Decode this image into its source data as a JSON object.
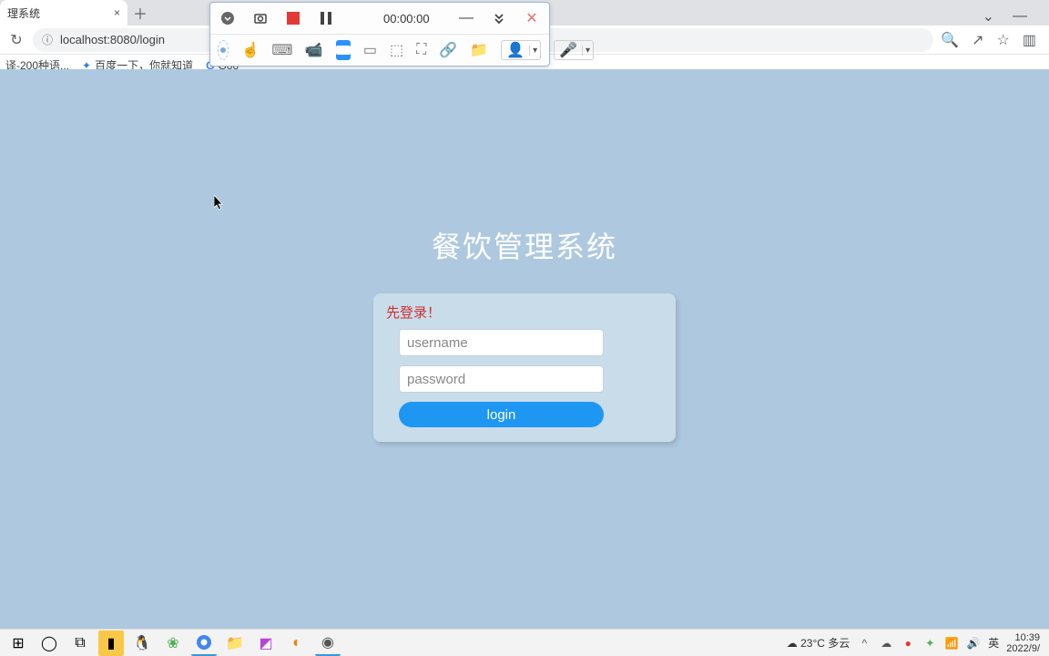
{
  "browser": {
    "tab_title": "理系统",
    "url": "localhost:8080/login",
    "bookmarks": [
      "译-200种语...",
      "百度一下，你就知道",
      "Goo"
    ]
  },
  "recorder": {
    "timer": "00:00:00"
  },
  "page": {
    "title": "餐饮管理系统",
    "message": "先登录！",
    "username_placeholder": "username",
    "password_placeholder": "password",
    "login_label": "login"
  },
  "system": {
    "weather": "23°C 多云",
    "ime": "英",
    "time": "10:39",
    "date": "2022/9/"
  }
}
